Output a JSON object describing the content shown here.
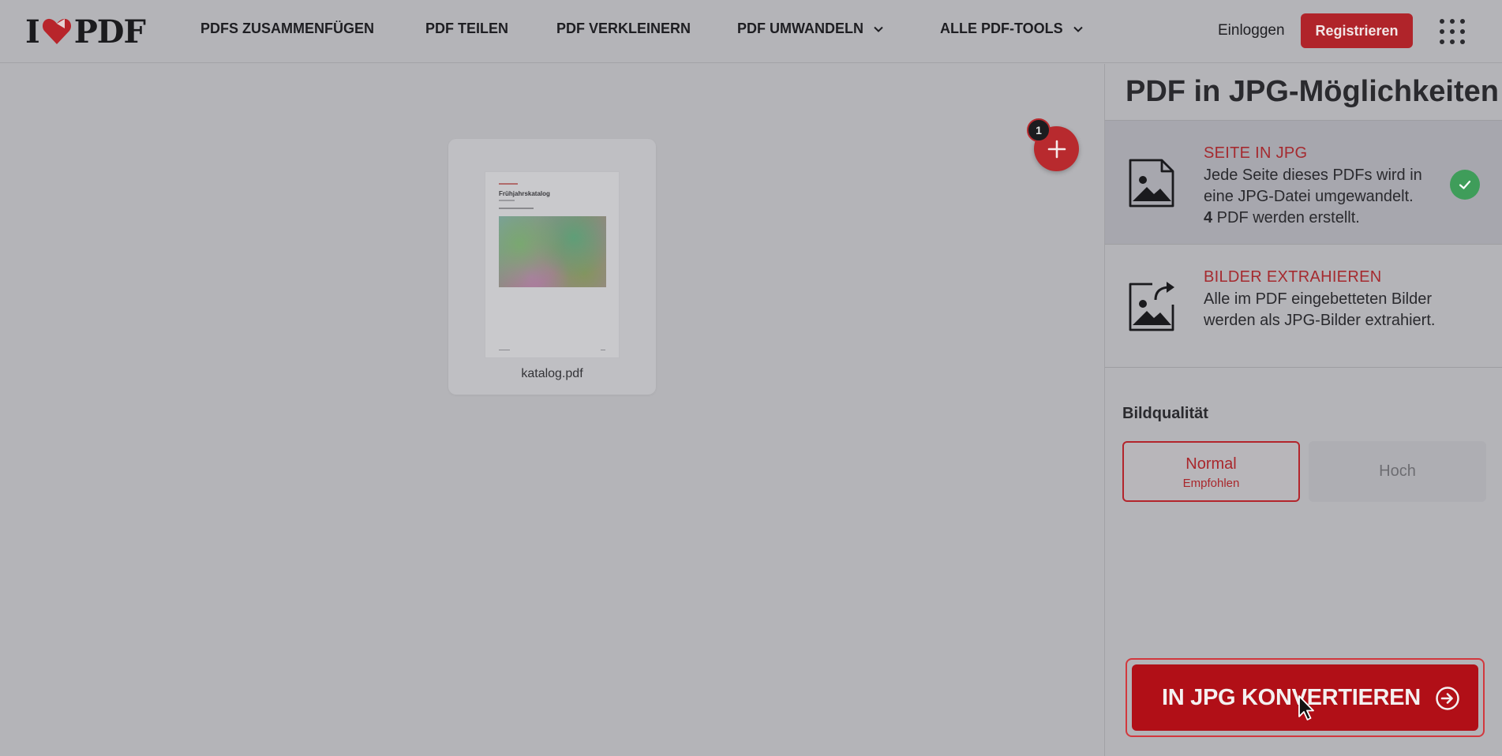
{
  "header": {
    "logo_left": "I",
    "logo_right": "PDF",
    "nav": [
      {
        "label": "PDFS ZUSAMMENFÜGEN"
      },
      {
        "label": "PDF TEILEN"
      },
      {
        "label": "PDF VERKLEINERN"
      },
      {
        "label": "PDF UMWANDELN"
      },
      {
        "label": "ALLE PDF-TOOLS"
      }
    ],
    "login_label": "Einloggen",
    "register_label": "Registrieren"
  },
  "workspace": {
    "file": {
      "name": "katalog.pdf",
      "thumb_title": "Frühjahrskatalog"
    },
    "file_count_badge": "1"
  },
  "sidebar": {
    "title": "PDF in JPG-Möglichkeiten",
    "options": [
      {
        "heading": "SEITE IN JPG",
        "desc_line": "Jede Seite dieses PDFs wird in eine JPG-Datei umgewandelt.",
        "count": "4",
        "count_suffix": " PDF werden erstellt.",
        "selected": true
      },
      {
        "heading": "BILDER EXTRAHIEREN",
        "desc": "Alle im PDF eingebetteten Bilder werden als JPG-Bilder extrahiert.",
        "selected": false
      }
    ],
    "quality": {
      "label": "Bildqualität",
      "normal_label": "Normal",
      "normal_sub": "Empfohlen",
      "high_label": "Hoch",
      "selected": "Normal"
    },
    "convert_label": "IN JPG KONVERTIEREN"
  },
  "colors": {
    "brand_red": "#b10f17",
    "success_green": "#3f9d5a"
  },
  "icons": [
    "heart-logo-icon",
    "chevron-down-icon",
    "apps-grid-icon",
    "plus-icon",
    "image-icon",
    "image-export-icon",
    "check-icon",
    "arrow-right-circle-icon",
    "mouse-cursor-icon"
  ]
}
